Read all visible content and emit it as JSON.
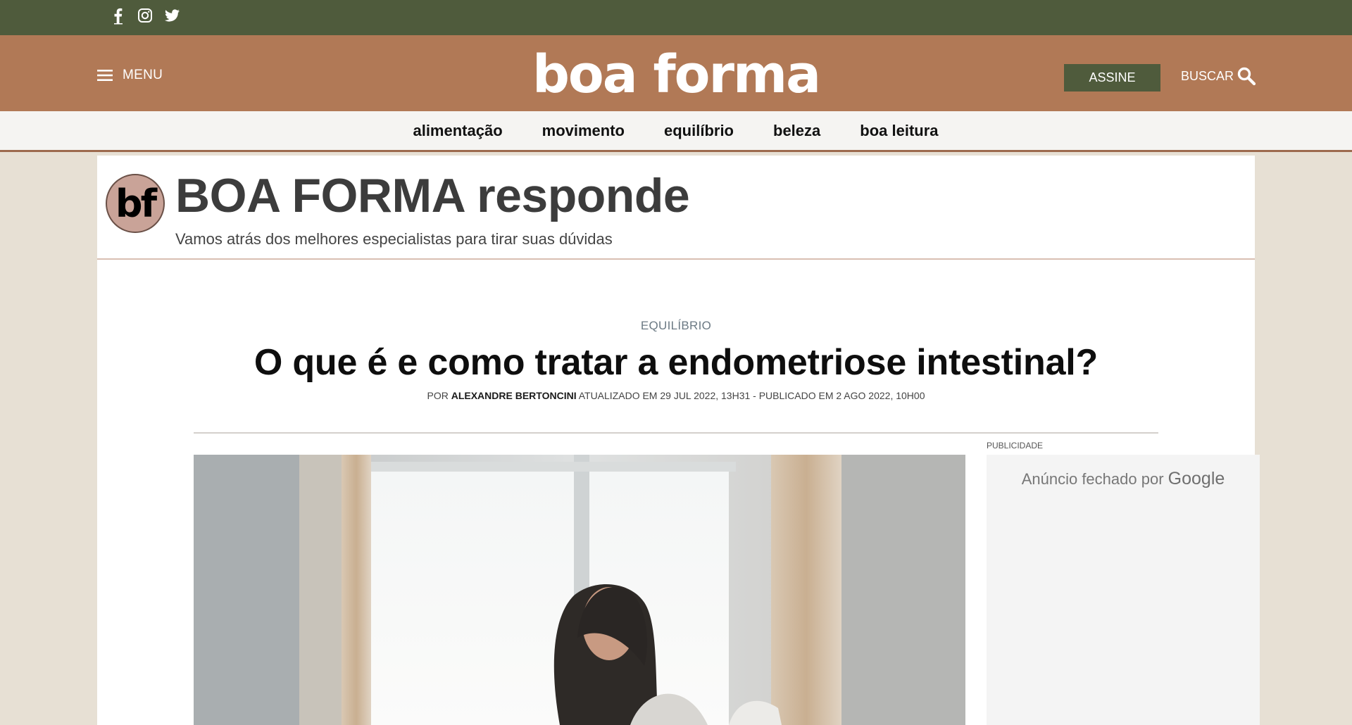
{
  "social": [
    {
      "name": "facebook-icon",
      "label": "Facebook"
    },
    {
      "name": "instagram-icon",
      "label": "Instagram"
    },
    {
      "name": "twitter-icon",
      "label": "Twitter"
    }
  ],
  "header": {
    "menu_label": "MENU",
    "logo": "boa forma",
    "subscribe_label": "ASSINE",
    "search_label": "BUSCAR"
  },
  "categories": [
    "alimentação",
    "movimento",
    "equilíbrio",
    "beleza",
    "boa leitura"
  ],
  "section": {
    "logo_text": "bf",
    "title": "BOA FORMA responde",
    "subtitle": "Vamos atrás dos melhores especialistas para tirar suas dúvidas"
  },
  "article": {
    "kicker": "EQUILÍBRIO",
    "headline": "O que é e como tratar a endometriose intestinal?",
    "byline_prefix": "POR",
    "author": "ALEXANDRE BERTONCINI",
    "byline_suffix": "ATUALIZADO EM 29 JUL 2022, 13H31 - PUBLICADO EM 2 AGO 2022, 10H00"
  },
  "ad": {
    "label": "PUBLICIDADE",
    "closed_text": "Anúncio fechado por",
    "google": "Google"
  },
  "colors": {
    "topbar": "#4f5b3c",
    "header": "#b17956",
    "page_bg": "#e7e0d4",
    "nav_border": "#9d6a4e"
  }
}
